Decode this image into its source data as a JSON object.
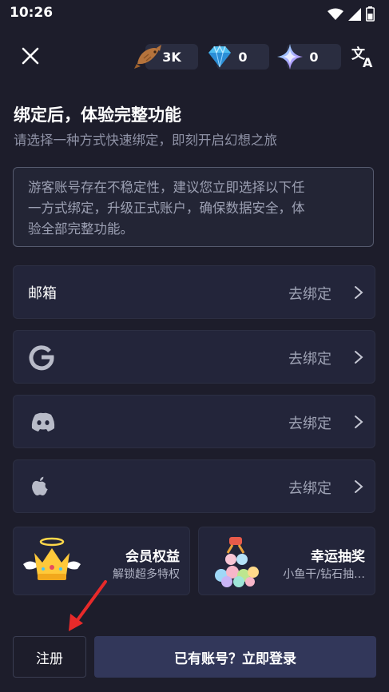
{
  "status_bar": {
    "time": "10:26"
  },
  "header": {
    "currencies": [
      {
        "icon": "fish-icon",
        "value": "3K"
      },
      {
        "icon": "diamond-icon",
        "value": "0"
      },
      {
        "icon": "star-icon",
        "value": "0"
      }
    ]
  },
  "page": {
    "title": "绑定后，体验完整功能",
    "subtitle": "请选择一种方式快速绑定，即刻开启幻想之旅",
    "notice_lines": [
      "游客账号存在不稳定性，建议您立即选择以下任",
      "一方式绑定，升级正式账户，确保数据安全，体",
      "验全部完整功能。"
    ]
  },
  "bind_options": [
    {
      "label": "邮箱",
      "action": "去绑定"
    },
    {
      "icon": "google-icon",
      "action": "去绑定"
    },
    {
      "icon": "discord-icon",
      "action": "去绑定"
    },
    {
      "icon": "apple-icon",
      "action": "去绑定"
    }
  ],
  "promos": [
    {
      "title": "会员权益",
      "subtitle": "解锁超多特权"
    },
    {
      "title": "幸运抽奖",
      "subtitle": "小鱼干/钻石抽…"
    }
  ],
  "footer": {
    "register_label": "注册",
    "login_label": "已有账号？立即登录"
  }
}
